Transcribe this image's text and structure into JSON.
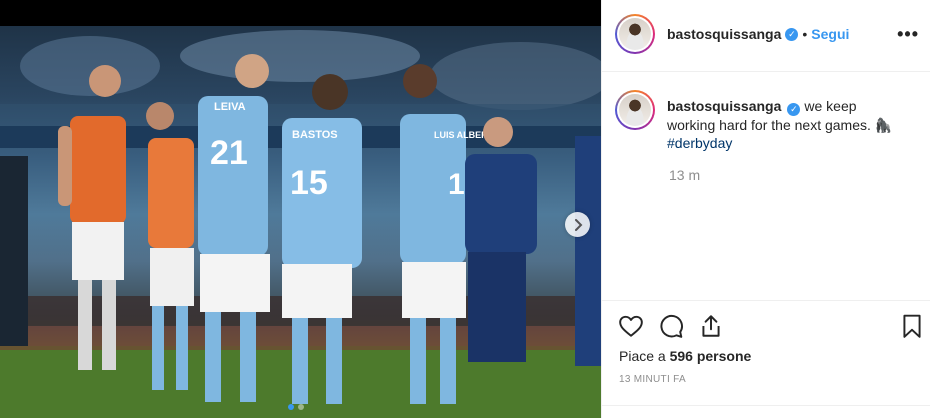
{
  "post": {
    "username": "bastosquissanga",
    "follow_label": "Segui",
    "separator": "•",
    "more_label": "•••",
    "caption_text": "we keep working hard for the next games. 🦍",
    "hashtag": "#derbyday",
    "time_ago": "13 m",
    "likes_prefix": "Piace a ",
    "likes_count": "596 persone",
    "timestamp": "13 MINUTI FA",
    "carousel": {
      "slides": 2,
      "active_slide": 1
    }
  },
  "photo": {
    "shirt_numbers": [
      "21",
      "15",
      "10"
    ],
    "shirt_names": [
      "LEIVA",
      "BASTOS",
      "LUIS ALBERTO"
    ]
  },
  "colors": {
    "accent": "#3897f0",
    "hashtag": "#003569",
    "muted": "#8e8e8e",
    "lazio_blue": "#7fb7e0"
  }
}
